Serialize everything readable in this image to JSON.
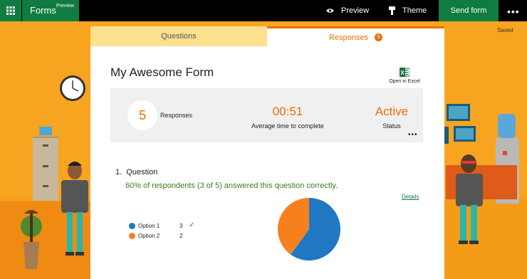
{
  "header": {
    "app_name": "Forms",
    "app_badge": "Preview",
    "preview_label": "Preview",
    "theme_label": "Theme",
    "send_label": "Send form",
    "more_label": "•••"
  },
  "status": {
    "saved": "Saved"
  },
  "tabs": {
    "questions": "Questions",
    "responses": "Responses",
    "responses_count": "5"
  },
  "form": {
    "title": "My Awesome Form",
    "open_excel": "Open in Excel"
  },
  "stats": {
    "responses_value": "5",
    "responses_label": "Responses",
    "avg_time_value": "00:51",
    "avg_time_label": "Average time to complete",
    "status_value": "Active",
    "status_label": "Status",
    "more": "•••"
  },
  "question": {
    "number": "1.",
    "title": "Question",
    "summary": "60% of respondents (3 of 5) answered this question correctly.",
    "details_link": "Details"
  },
  "chart_data": {
    "type": "pie",
    "categories": [
      "Option 1",
      "Option 2"
    ],
    "values": [
      3,
      2
    ],
    "colors": [
      "#1f78c1",
      "#f7801e"
    ],
    "correct": [
      true,
      false
    ]
  },
  "colors": {
    "accent": "#ef6c00",
    "brand": "#107c41",
    "background": "#f7a520"
  }
}
